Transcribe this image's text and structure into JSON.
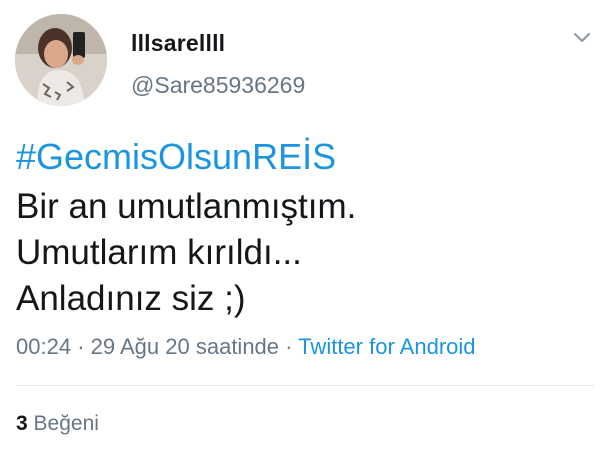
{
  "author": {
    "display_name": "lllsarellll",
    "handle": "@Sare85936269",
    "avatar_icon": "profile-photo"
  },
  "menu_icon": "chevron-down-icon",
  "tweet": {
    "hashtag": "#GecmisOlsunREİS",
    "lines": [
      "Bir an umutlanmıştım.",
      "Umutlarım kırıldı...",
      "Anladınız siz ;)"
    ]
  },
  "meta": {
    "time": "00:24",
    "separator": "·",
    "date_text": "29 Ağu 20 saatinde",
    "source": "Twitter for Android"
  },
  "stats": {
    "likes_count": "3",
    "likes_label": "Beğeni"
  },
  "colors": {
    "link": "#1b95e0",
    "secondary_text": "#657786",
    "primary_text": "#14171a",
    "divider": "#e1e8ed"
  }
}
